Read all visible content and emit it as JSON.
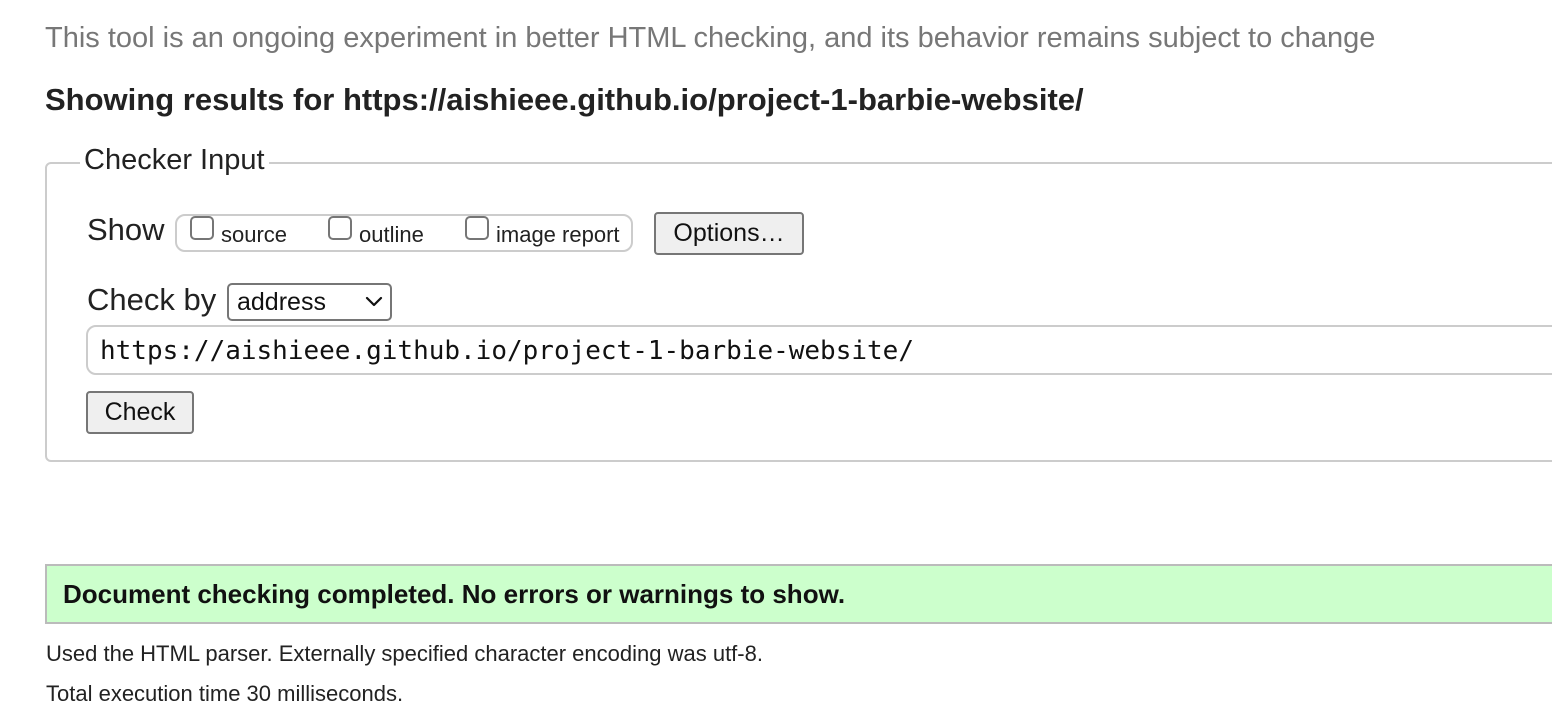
{
  "header": {
    "subtitle": "This tool is an ongoing experiment in better HTML checking, and its behavior remains subject to change",
    "results_heading": "Showing results for https://aishieee.github.io/project-1-barbie-website/"
  },
  "checker_input": {
    "legend": "Checker Input",
    "show_label": "Show",
    "show_options": [
      {
        "label": "source",
        "checked": false
      },
      {
        "label": "outline",
        "checked": false
      },
      {
        "label": "image report",
        "checked": false
      }
    ],
    "options_button_label": "Options…",
    "check_by_label": "Check by",
    "check_by_selected": "address",
    "url_value": "https://aishieee.github.io/project-1-barbie-website/",
    "check_button_label": "Check"
  },
  "result": {
    "success_message": "Document checking completed. No errors or warnings to show.",
    "parser_info": "Used the HTML parser. Externally specified character encoding was utf-8.",
    "timing_info": "Total execution time 30 milliseconds.",
    "success_color": "#ccffcc"
  }
}
